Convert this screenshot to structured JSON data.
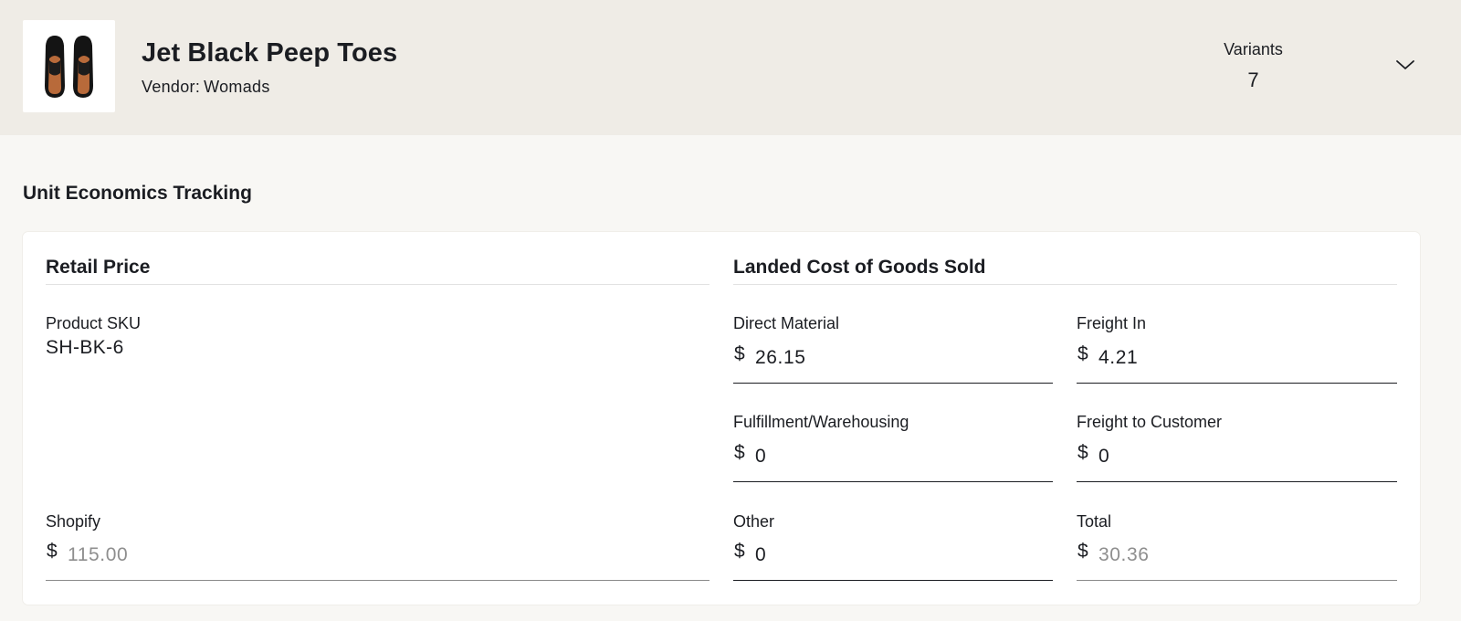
{
  "product": {
    "title": "Jet Black Peep Toes",
    "vendor_label": "Vendor:",
    "vendor_name": "Womads",
    "thumbnail_icon": "sandal-pair-image"
  },
  "variants": {
    "label": "Variants",
    "count": "7",
    "toggle_icon": "chevron-down-icon"
  },
  "section": {
    "title": "Unit Economics Tracking"
  },
  "retail": {
    "heading": "Retail Price",
    "sku_label": "Product SKU",
    "sku_value": "SH-BK-6",
    "shopify_label": "Shopify",
    "shopify_currency": "$",
    "shopify_value": "115.00"
  },
  "landed_cost": {
    "heading": "Landed Cost of Goods Sold",
    "fields": [
      {
        "label": "Direct Material",
        "currency": "$",
        "value": "26.15"
      },
      {
        "label": "Freight In",
        "currency": "$",
        "value": "4.21"
      },
      {
        "label": "Fulfillment/Warehousing",
        "currency": "$",
        "value": "0"
      },
      {
        "label": "Freight to Customer",
        "currency": "$",
        "value": "0"
      },
      {
        "label": "Other",
        "currency": "$",
        "value": "0"
      },
      {
        "label": "Total",
        "currency": "$",
        "value": "30.36"
      }
    ]
  },
  "colors": {
    "header_bg": "#efece6",
    "page_bg": "#f8f7f4",
    "card_bg": "#ffffff",
    "text": "#1b1d22",
    "readonly_text": "#8e8e8e"
  }
}
